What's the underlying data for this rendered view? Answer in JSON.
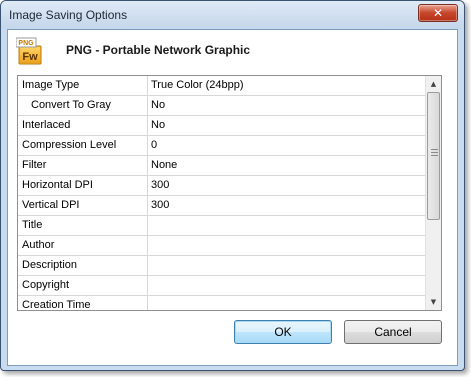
{
  "window": {
    "title": "Image Saving Options",
    "close_glyph": "✕"
  },
  "header": {
    "format_title": "PNG - Portable Network Graphic",
    "icon": {
      "name": "png-fw-file-icon",
      "badge_text": "PNG",
      "letters": "Fw"
    }
  },
  "grid": {
    "rows": [
      {
        "name": "Image Type",
        "value": "True Color (24bpp)"
      },
      {
        "name": "Convert To Gray",
        "value": "No"
      },
      {
        "name": "Interlaced",
        "value": "No"
      },
      {
        "name": "Compression Level",
        "value": "0"
      },
      {
        "name": "Filter",
        "value": "None"
      },
      {
        "name": "Horizontal DPI",
        "value": "300"
      },
      {
        "name": "Vertical DPI",
        "value": "300"
      },
      {
        "name": "Title",
        "value": ""
      },
      {
        "name": "Author",
        "value": ""
      },
      {
        "name": "Description",
        "value": ""
      },
      {
        "name": "Copyright",
        "value": ""
      },
      {
        "name": "Creation Time",
        "value": ""
      }
    ],
    "scroll_up_glyph": "▲",
    "scroll_down_glyph": "▼"
  },
  "buttons": {
    "ok_label": "OK",
    "cancel_label": "Cancel"
  }
}
